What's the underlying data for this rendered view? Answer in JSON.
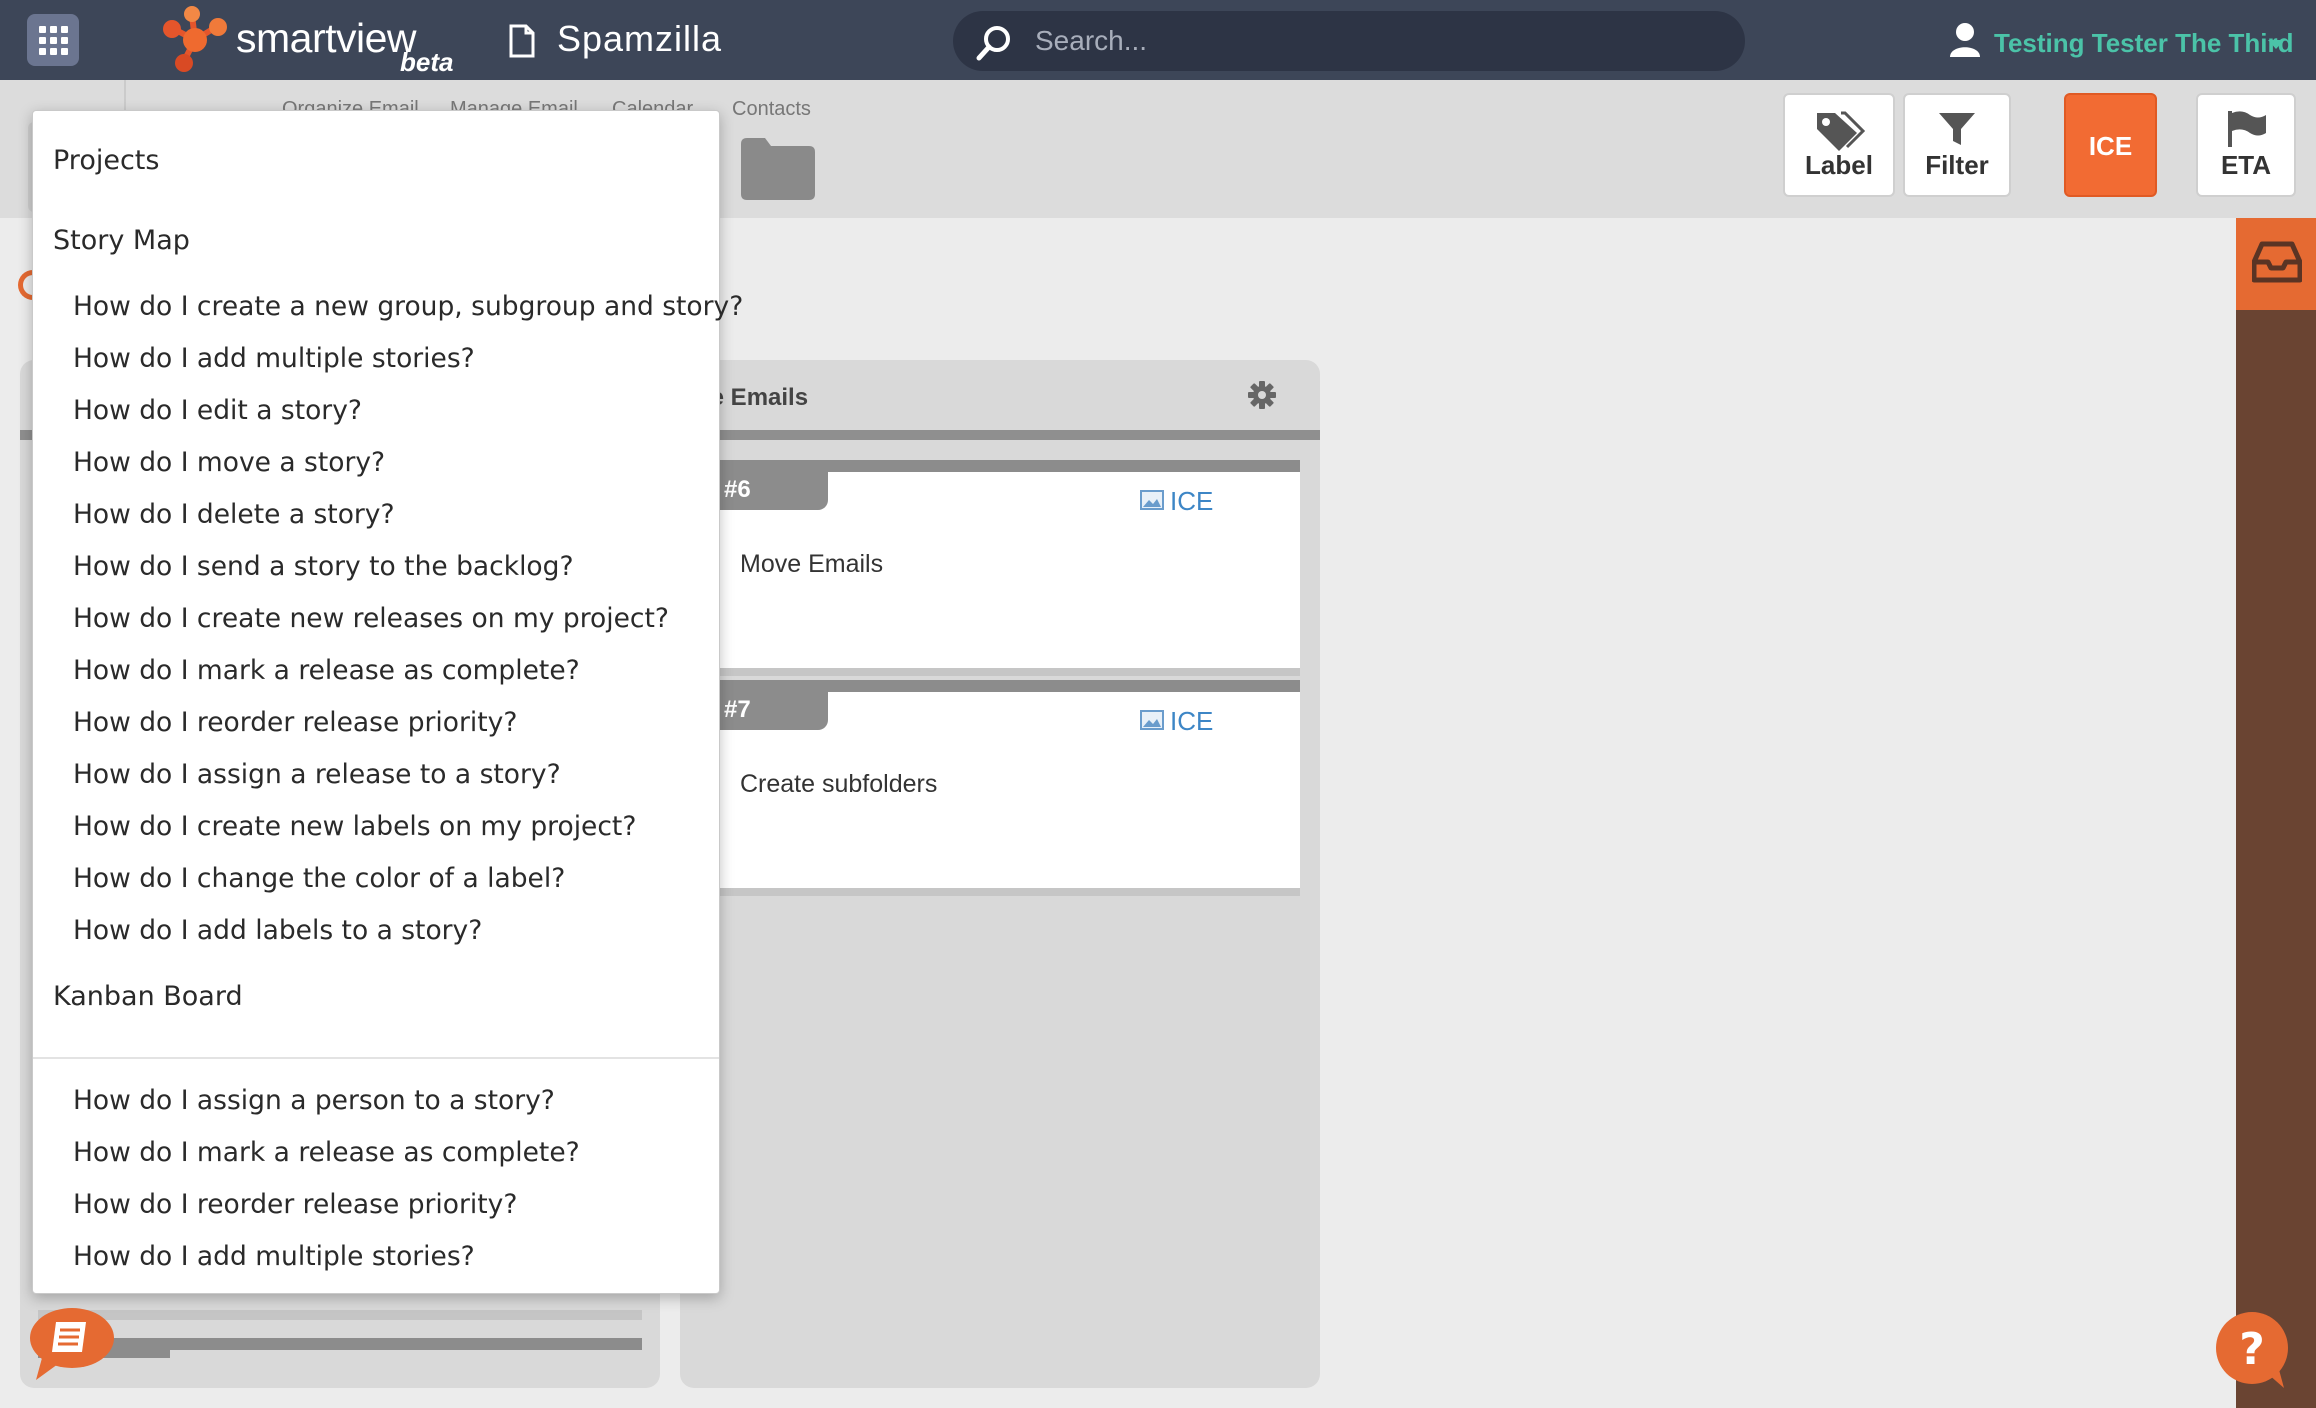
{
  "app": {
    "brand_word": "smartview",
    "brand_suffix": "beta",
    "project_name": "Spamzilla"
  },
  "search": {
    "placeholder": "Search..."
  },
  "user": {
    "name": "Testing Tester The Third"
  },
  "subnav": {
    "tabs": [
      "Organize Email",
      "Manage Email",
      "Calendar",
      "Contacts"
    ]
  },
  "toolbar": {
    "label": "Label",
    "filter": "Filter",
    "ice": "ICE",
    "eta": "ETA"
  },
  "board": {
    "column_title": "le Emails",
    "cards": [
      {
        "number": "#6",
        "tag": "ICE",
        "title": "Move Emails"
      },
      {
        "number": "#7",
        "tag": "ICE",
        "title": "Create subfolders"
      }
    ]
  },
  "help": {
    "projects_heading": "Projects",
    "story_map_heading": "Story Map",
    "story_map_items": [
      "How do I create a new group, subgroup and story?",
      "How do I add multiple stories?",
      "How do I edit a story?",
      "How do I move a story?",
      "How do I delete a story?",
      "How do I send a story to the backlog?",
      "How do I create new releases on my project?",
      "How do I mark a release as complete?",
      "How do I reorder release priority?",
      "How do I assign a release to a story?",
      "How do I create new labels on my project?",
      "How do I change the color of a label?",
      "How do I add labels to a story?"
    ],
    "kanban_heading": "Kanban Board",
    "kanban_items": [
      "How do I assign a person to a story?",
      "How do I mark a release as complete?",
      "How do I reorder release priority?",
      "How do I add multiple stories?"
    ]
  },
  "colors": {
    "topbar": "#3d4658",
    "accent_orange": "#f26b33",
    "user_teal": "#4bc3a8",
    "rail_brown": "#6a4432",
    "tag_blue": "#3d86c6"
  },
  "icons": {
    "apps": "grid-icon",
    "logo": "network-logo",
    "project": "document-icon",
    "search": "search-icon",
    "user": "user-icon",
    "label": "tag-icon",
    "filter": "funnel-icon",
    "eta": "flag-icon",
    "inbox": "inbox-icon",
    "settings": "gear-icon",
    "card_tag": "image-icon",
    "guide": "book-chat-icon",
    "help": "question-chat-icon"
  }
}
